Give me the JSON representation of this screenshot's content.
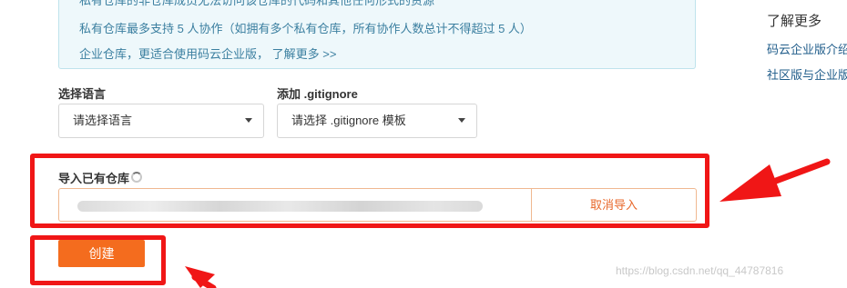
{
  "info_box": {
    "line0": "私有仓库的非仓库成员无法访问该仓库的代码和其他任何形式的资源",
    "line1": "私有仓库最多支持 5 人协作（如拥有多个私有仓库，所有协作人数总计不得超过 5 人）",
    "line2_text": "企业仓库，更适合使用码云企业版，",
    "line2_link": "了解更多 >>"
  },
  "learn_more": {
    "title": "了解更多",
    "links": [
      "码云企业版介绍",
      "社区版与企业版"
    ]
  },
  "language": {
    "label": "选择语言",
    "value": "请选择语言"
  },
  "gitignore": {
    "label": "添加 .gitignore",
    "value": "请选择 .gitignore 模板"
  },
  "import_repo": {
    "label": "导入已有仓库",
    "input_value": "",
    "cancel_label": "取消导入"
  },
  "create": {
    "label": "创建"
  },
  "watermark": "https://blog.csdn.net/qq_44787816",
  "colors": {
    "accent": "#f46c1e",
    "annotation": "#f01616",
    "info_bg": "#eef8fb"
  }
}
